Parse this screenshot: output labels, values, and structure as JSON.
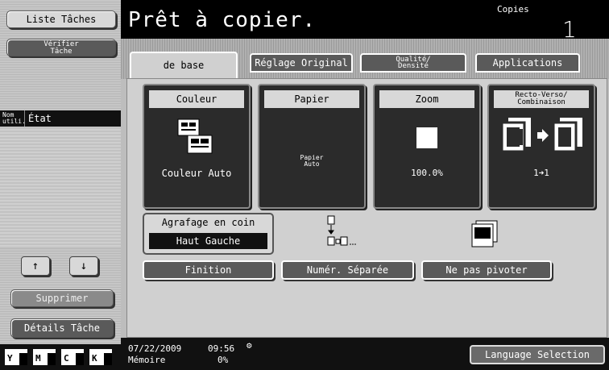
{
  "left": {
    "job_list_label": "Liste Tâches",
    "check_job_label": "Vérifier\nTâche",
    "col_user": "Nom\nutili.",
    "col_status": "État",
    "delete_label": "Supprimer",
    "details_label": "Détails Tâche",
    "up_arrow": "↑",
    "down_arrow": "↓",
    "toners": [
      {
        "key": "Y",
        "level": 0.75
      },
      {
        "key": "M",
        "level": 0.75
      },
      {
        "key": "C",
        "level": 0.75
      },
      {
        "key": "K",
        "level": 0.75
      }
    ]
  },
  "header": {
    "title": "Prêt à copier.",
    "copies_label": "Copies",
    "copies_count": "1"
  },
  "tabs": [
    {
      "label": "de base"
    },
    {
      "label": "Réglage Original"
    },
    {
      "label": "Qualité/\nDensité"
    },
    {
      "label": "Applications"
    }
  ],
  "functions": {
    "color": {
      "title": "Couleur",
      "value": "Couleur Auto"
    },
    "paper": {
      "title": "Papier",
      "value": "Papier\nAuto"
    },
    "zoom": {
      "title": "Zoom",
      "value": "100.0%"
    },
    "duplex": {
      "title": "Recto-Verso/\nCombinaison",
      "value": "1➜1"
    }
  },
  "staple": {
    "label": "Agrafage en coin",
    "value": "Haut Gauche"
  },
  "buttons": {
    "finishing": "Finition",
    "separate_scan": "Numér. Séparée",
    "no_rotate": "Ne pas pivoter"
  },
  "status": {
    "date": "07/22/2009",
    "time": "09:56",
    "memory_label": "Mémoire",
    "memory_value": "0%"
  },
  "language_button": "Language Selection"
}
